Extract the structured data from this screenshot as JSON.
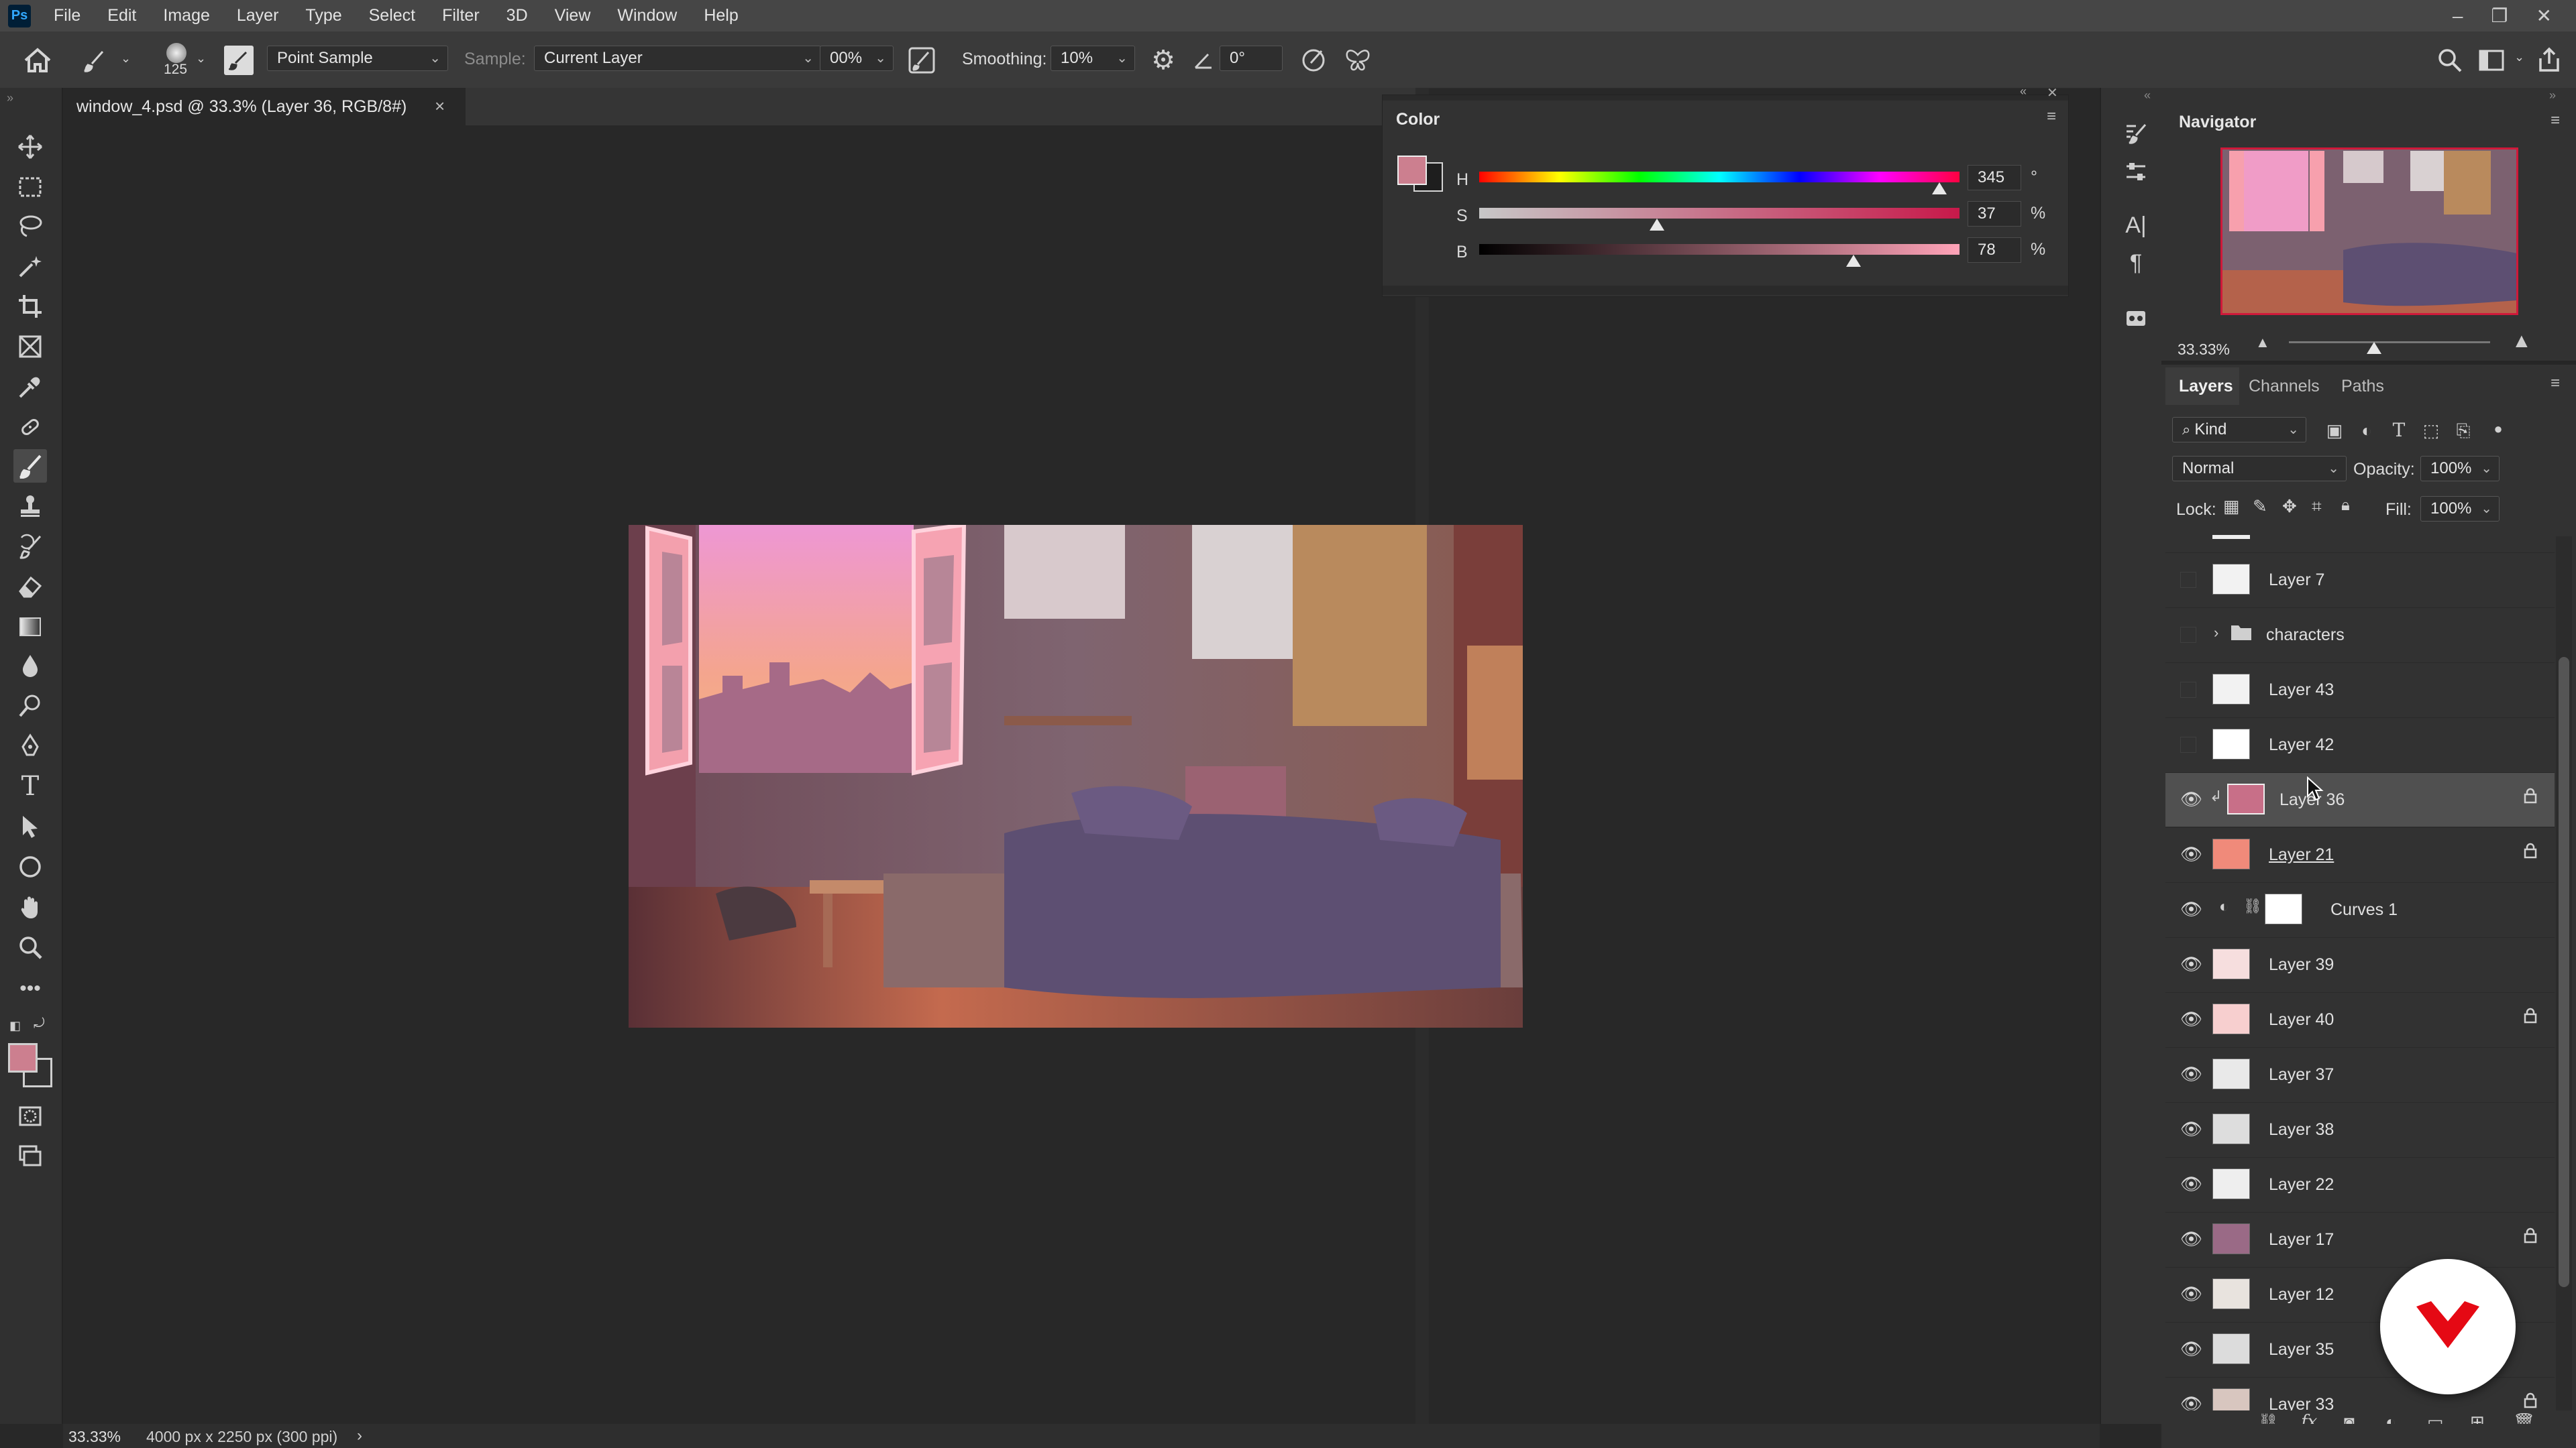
{
  "menubar": {
    "logo": "Ps",
    "items": [
      "File",
      "Edit",
      "Image",
      "Layer",
      "Type",
      "Select",
      "Filter",
      "3D",
      "View",
      "Window",
      "Help"
    ]
  },
  "options": {
    "brush_size": "125",
    "sample_size": "Point Sample",
    "sample_label": "Sample:",
    "sample_value": "Current Layer",
    "opacity_value": "00%",
    "smoothing_label": "Smoothing:",
    "smoothing_value": "10%",
    "angle_value": "0°"
  },
  "document_tab": {
    "title": "window_4.psd @ 33.3% (Layer 36, RGB/8#)",
    "close": "×"
  },
  "color_panel": {
    "title": "Color",
    "rows": [
      {
        "label": "H",
        "value": "345",
        "unit": "°",
        "level": 0.958
      },
      {
        "label": "S",
        "value": "37",
        "unit": "%",
        "level": 0.37
      },
      {
        "label": "B",
        "value": "78",
        "unit": "%",
        "level": 0.78
      }
    ],
    "foreground_color": "#cc7f8f",
    "background_color": "#1e1e1e"
  },
  "navigator": {
    "title": "Navigator",
    "zoom": "33.33%"
  },
  "layers_panel": {
    "tabs": [
      "Layers",
      "Channels",
      "Paths"
    ],
    "filter_kind": "Kind",
    "blend_mode": "Normal",
    "opacity_label": "Opacity:",
    "opacity_value": "100%",
    "lock_label": "Lock:",
    "fill_label": "Fill:",
    "fill_value": "100%",
    "layers": [
      {
        "name": "Layer 7",
        "visible": false,
        "locked": false,
        "thumb": "#f2f2f2"
      },
      {
        "name": "characters",
        "visible": false,
        "locked": false,
        "thumb": "folder"
      },
      {
        "name": "Layer 43",
        "visible": false,
        "locked": false,
        "thumb": "#f2f2f2"
      },
      {
        "name": "Layer 42",
        "visible": false,
        "locked": false,
        "thumb": "#ffffff"
      },
      {
        "name": "Layer 36",
        "visible": true,
        "locked": true,
        "thumb": "#c86f88",
        "selected": true
      },
      {
        "name": "Layer 21",
        "visible": true,
        "locked": true,
        "thumb": "#f08a7a"
      },
      {
        "name": "Curves 1",
        "visible": true,
        "locked": false,
        "thumb": "#ffffff"
      },
      {
        "name": "Layer 39",
        "visible": true,
        "locked": false,
        "thumb": "#f6dede"
      },
      {
        "name": "Layer 40",
        "visible": true,
        "locked": true,
        "thumb": "#f7cfcf"
      },
      {
        "name": "Layer 37",
        "visible": true,
        "locked": false,
        "thumb": "#e9e9e9"
      },
      {
        "name": "Layer 38",
        "visible": true,
        "locked": false,
        "thumb": "#dddddd"
      },
      {
        "name": "Layer 22",
        "visible": true,
        "locked": false,
        "thumb": "#eeeeee"
      },
      {
        "name": "Layer 17",
        "visible": true,
        "locked": true,
        "thumb": "#9a6a86"
      },
      {
        "name": "Layer 12",
        "visible": true,
        "locked": false,
        "thumb": "#e8e3de"
      },
      {
        "name": "Layer 35",
        "visible": true,
        "locked": false,
        "thumb": "#dcdcdc"
      },
      {
        "name": "Layer 33",
        "visible": true,
        "locked": true,
        "thumb": "#d8c6bf"
      }
    ]
  },
  "status": {
    "zoom": "33.33%",
    "doc_info": "4000 px x 2250 px (300 ppi)",
    "arrow": "›"
  }
}
